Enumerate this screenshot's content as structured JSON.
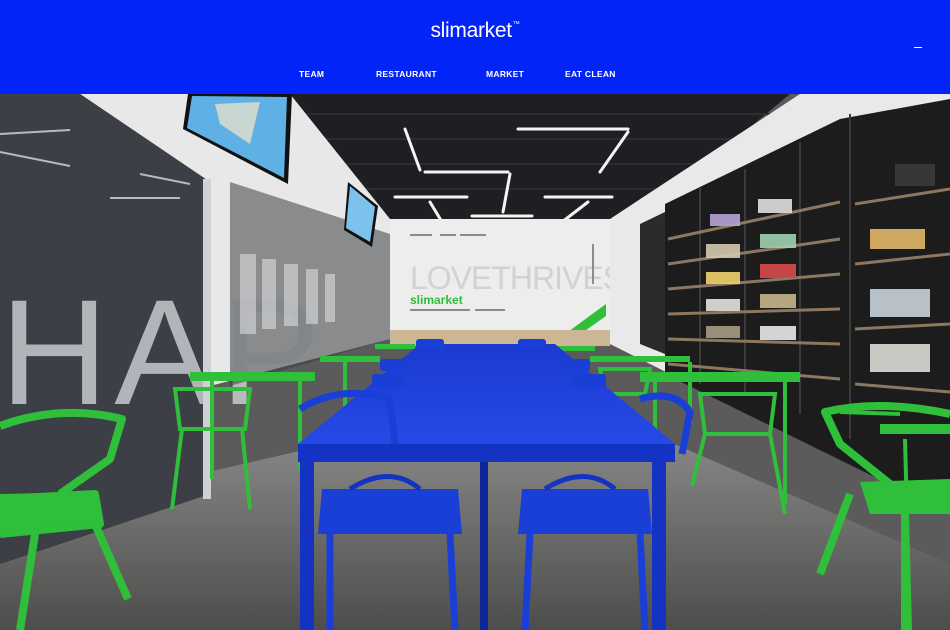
{
  "header": {
    "logo_text": "slimarket",
    "logo_mark": "™",
    "background_color": "#0324f6",
    "menu_icon": "hamburger-menu-icon"
  },
  "nav": {
    "items": [
      {
        "label": "TEAM"
      },
      {
        "label": "RESTAURANT"
      },
      {
        "label": "MARKET"
      },
      {
        "label": "EAT CLEAN"
      }
    ]
  },
  "hero": {
    "image_name": "restaurant-interior-photo",
    "wall_text": "LOVETHRIVES",
    "wall_logo": "slimarket",
    "glass_text": "HAP",
    "colors": {
      "table_blue": "#1a3fd6",
      "chair_green": "#2fbf3a"
    }
  }
}
